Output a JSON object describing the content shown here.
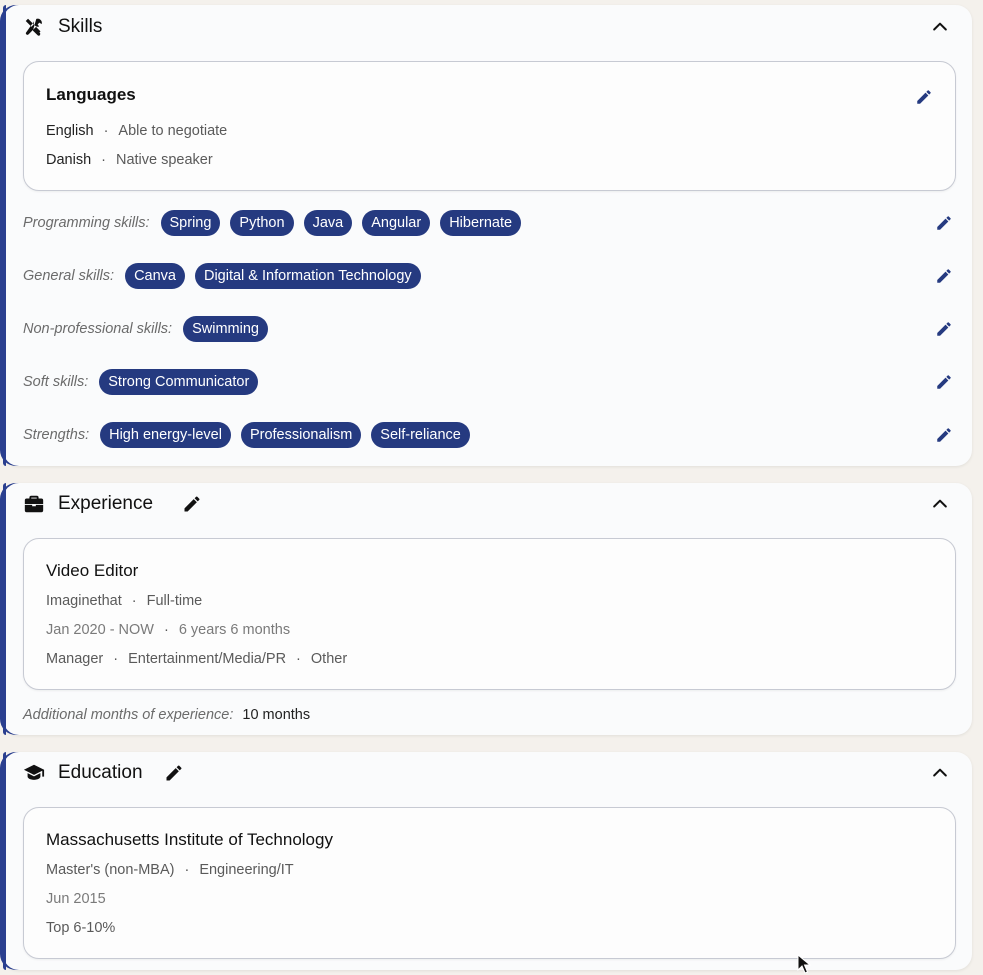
{
  "skills": {
    "title": "Skills",
    "languages": {
      "title": "Languages",
      "items": [
        {
          "language": "English",
          "level": "Able to negotiate"
        },
        {
          "language": "Danish",
          "level": "Native speaker"
        }
      ]
    },
    "rows": [
      {
        "label": "Programming skills:",
        "chips": [
          "Spring",
          "Python",
          "Java",
          "Angular",
          "Hibernate"
        ]
      },
      {
        "label": "General skills:",
        "chips": [
          "Canva",
          "Digital & Information Technology"
        ]
      },
      {
        "label": "Non-professional skills:",
        "chips": [
          "Swimming"
        ]
      },
      {
        "label": "Soft skills:",
        "chips": [
          "Strong Communicator"
        ]
      },
      {
        "label": "Strengths:",
        "chips": [
          "High energy-level",
          "Professionalism",
          "Self-reliance"
        ]
      }
    ]
  },
  "experience": {
    "title": "Experience",
    "job": {
      "title": "Video Editor",
      "company": "Imaginethat",
      "type": "Full-time",
      "period": "Jan 2020 - NOW",
      "duration": "6 years 6 months",
      "role": "Manager",
      "industry": "Entertainment/Media/PR",
      "category": "Other"
    },
    "additional_label": "Additional months of experience:",
    "additional_value": "10 months"
  },
  "education": {
    "title": "Education",
    "school": "Massachusetts Institute of Technology",
    "degree": "Master's (non-MBA)",
    "field": "Engineering/IT",
    "date": "Jun 2015",
    "rank": "Top 6-10%"
  },
  "icons": {
    "skills": "tools-icon",
    "experience": "briefcase-icon",
    "education": "graduation-cap-icon",
    "edit": "pencil-icon",
    "collapse": "chevron-up-icon"
  },
  "colors": {
    "accent": "#253a80",
    "section_bar": "#2a3f8f",
    "background": "#f4f1ec"
  }
}
